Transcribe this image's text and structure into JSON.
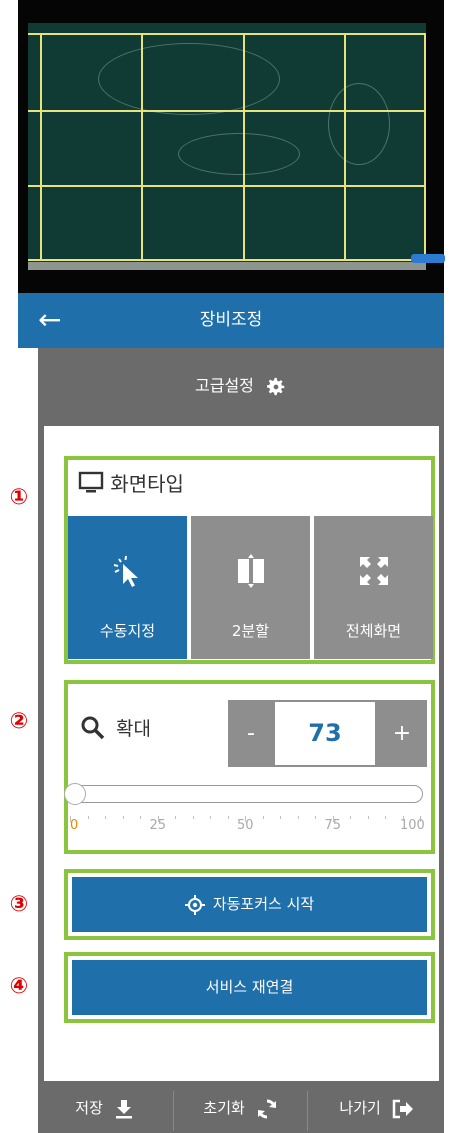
{
  "header": {
    "title": "장비조정",
    "back_symbol": "←"
  },
  "advanced": {
    "label": "고급설정",
    "icon": "gear-icon"
  },
  "screen_type": {
    "title": "화면타입",
    "icon": "monitor-icon",
    "options": [
      {
        "label": "수동지정",
        "icon": "pointer-click-icon",
        "selected": true
      },
      {
        "label": "2분할",
        "icon": "split-icon",
        "selected": false
      },
      {
        "label": "전체화면",
        "icon": "expand-icon",
        "selected": false
      }
    ]
  },
  "zoom": {
    "label": "확대",
    "icon": "search-icon",
    "minus": "-",
    "plus": "+",
    "value": "73",
    "slider_value": 0,
    "ticks": [
      "0",
      "25",
      "50",
      "75",
      "100"
    ]
  },
  "autofocus": {
    "label": "자동포커스 시작",
    "icon": "target-icon"
  },
  "reconnect": {
    "label": "서비스 재연결"
  },
  "bottom": {
    "save": "저장",
    "reset": "초기화",
    "exit": "나가기"
  },
  "annotations": [
    "①",
    "②",
    "③",
    "④"
  ],
  "colors": {
    "accent": "#1f6fab",
    "highlight": "#8bc53f",
    "panel": "#6b6b6b",
    "marker": "#e00000"
  }
}
